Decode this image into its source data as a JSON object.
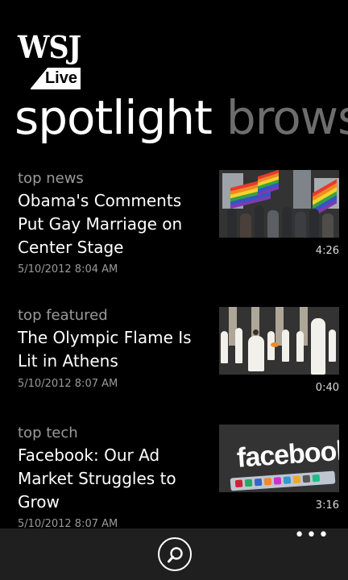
{
  "logo": {
    "wsj": "WSJ",
    "live": "Live"
  },
  "pivot": {
    "active": "spotlight",
    "next": "brows"
  },
  "stories": [
    {
      "category": "top news",
      "headline": "Obama's Comments Put Gay Marriage on Center Stage",
      "date": "5/10/2012 8:04 AM",
      "duration": "4:26"
    },
    {
      "category": "top featured",
      "headline": "The Olympic Flame Is Lit in Athens",
      "date": "5/10/2012 8:07 AM",
      "duration": "0:40"
    },
    {
      "category": "top tech",
      "headline": "Facebook: Our Ad Market Struggles to Grow",
      "date": "5/10/2012 8:07 AM",
      "duration": "3:16",
      "thumb_text": "facebook"
    }
  ],
  "appbar": {
    "more": "•••",
    "search_icon": "search-icon"
  }
}
